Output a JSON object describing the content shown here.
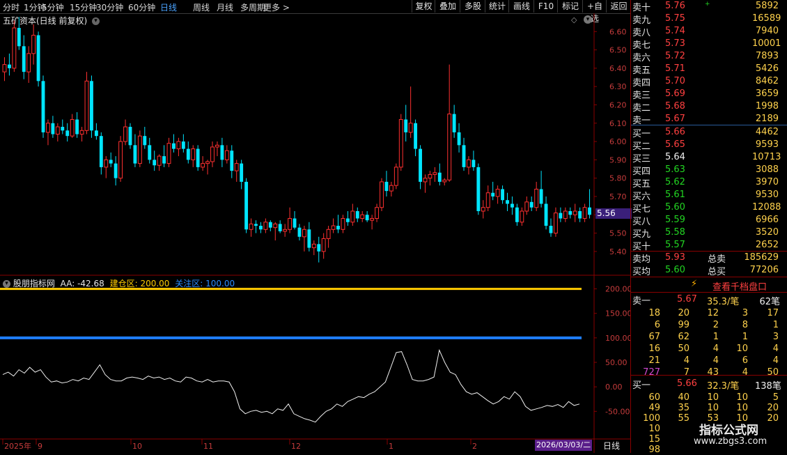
{
  "toolbar": {
    "periods": [
      "分时",
      "1分钟",
      "5分钟",
      "15分钟",
      "30分钟",
      "60分钟",
      "日线",
      "周线",
      "月线",
      "多周期",
      "更多 >"
    ],
    "active": "日线",
    "right_buttons": [
      "复权",
      "叠加",
      "多股",
      "统计",
      "画线",
      "F10",
      "标记",
      "+自选",
      "返回"
    ]
  },
  "stock": {
    "title": "五矿资本(日线 前复权)",
    "current_price_tag": "5.56"
  },
  "price_axis": [
    "6.60",
    "6.50",
    "6.40",
    "6.30",
    "6.20",
    "6.10",
    "6.00",
    "5.90",
    "5.80",
    "5.70",
    "5.60",
    "5.50",
    "5.40"
  ],
  "indicator": {
    "name": "股朋指标网",
    "aa_label": "AA: -42.68",
    "build_label": "建仓区: 200.00",
    "watch_label": "关注区: 100.00",
    "axis": [
      "200.00",
      "150.00",
      "100.00",
      "50.00",
      "0.00",
      "-50.00"
    ]
  },
  "time_axis": {
    "labels": [
      "2025年",
      "9",
      "10",
      "11",
      "12",
      "1",
      "2"
    ],
    "cursor_date": "2026/03/03/二",
    "period_label": "日线"
  },
  "order_book": {
    "asks": [
      {
        "label": "卖十",
        "price": "5.76",
        "vol": "5892",
        "mark": "+"
      },
      {
        "label": "卖九",
        "price": "5.75",
        "vol": "16589",
        "mark": ""
      },
      {
        "label": "卖八",
        "price": "5.74",
        "vol": "7940",
        "mark": ""
      },
      {
        "label": "卖七",
        "price": "5.73",
        "vol": "10001",
        "mark": ""
      },
      {
        "label": "卖六",
        "price": "5.72",
        "vol": "7893",
        "mark": ""
      },
      {
        "label": "卖五",
        "price": "5.71",
        "vol": "5426",
        "mark": ""
      },
      {
        "label": "卖四",
        "price": "5.70",
        "vol": "8462",
        "mark": ""
      },
      {
        "label": "卖三",
        "price": "5.69",
        "vol": "3659",
        "mark": ""
      },
      {
        "label": "卖二",
        "price": "5.68",
        "vol": "1998",
        "mark": ""
      },
      {
        "label": "卖一",
        "price": "5.67",
        "vol": "2189",
        "mark": ""
      }
    ],
    "bids": [
      {
        "label": "买一",
        "price": "5.66",
        "vol": "4462",
        "color": "red"
      },
      {
        "label": "买二",
        "price": "5.65",
        "vol": "9593",
        "color": "red"
      },
      {
        "label": "买三",
        "price": "5.64",
        "vol": "10713",
        "color": "white"
      },
      {
        "label": "买四",
        "price": "5.63",
        "vol": "3088",
        "color": "green"
      },
      {
        "label": "买五",
        "price": "5.62",
        "vol": "3970",
        "color": "green"
      },
      {
        "label": "买六",
        "price": "5.61",
        "vol": "9530",
        "color": "green"
      },
      {
        "label": "买七",
        "price": "5.60",
        "vol": "12088",
        "color": "green"
      },
      {
        "label": "买八",
        "price": "5.59",
        "vol": "6966",
        "color": "green"
      },
      {
        "label": "买九",
        "price": "5.58",
        "vol": "3520",
        "color": "green"
      },
      {
        "label": "买十",
        "price": "5.57",
        "vol": "2652",
        "color": "green"
      }
    ],
    "avg_sell": {
      "label": "卖均",
      "price": "5.93",
      "total_label": "总卖",
      "total": "185629"
    },
    "avg_buy": {
      "label": "买均",
      "price": "5.60",
      "total_label": "总买",
      "total": "77206"
    },
    "thousand_button": "查看千档盘口",
    "sell1": {
      "label": "卖一",
      "price": "5.67",
      "amount": "35.3/笔",
      "count": "62笔"
    },
    "sell_queue": [
      [
        "18",
        "20",
        "12",
        "3",
        "17"
      ],
      [
        "6",
        "99",
        "2",
        "8",
        "1"
      ],
      [
        "67",
        "62",
        "1",
        "1",
        "3"
      ],
      [
        "16",
        "50",
        "4",
        "10",
        "4"
      ],
      [
        "21",
        "4",
        "4",
        "6",
        "4"
      ],
      [
        "727",
        "7",
        "43",
        "4",
        "50"
      ]
    ],
    "buy1": {
      "label": "买一",
      "price": "5.66",
      "amount": "32.3/笔",
      "count": "138笔"
    },
    "buy_queue": [
      [
        "60",
        "40",
        "10",
        "10",
        "5"
      ],
      [
        "49",
        "35",
        "10",
        "10",
        "20"
      ],
      [
        "100",
        "55",
        "53",
        "10",
        "20"
      ],
      [
        "10",
        "",
        "",
        "",
        ""
      ],
      [
        "15",
        "",
        "",
        "",
        ""
      ],
      [
        "98",
        "",
        "",
        "",
        ""
      ]
    ]
  },
  "watermark": {
    "line1": "指标公式网",
    "line2": "www.zbgs3.com"
  },
  "chart_data": {
    "type": "candlestick",
    "x": [
      "2025-08-29",
      "2025-09",
      "2025-10",
      "2025-11",
      "2025-12",
      "2026-01",
      "2026-02",
      "2026-03-03"
    ],
    "candles": [
      [
        6.38,
        6.46,
        6.33,
        6.42
      ],
      [
        6.42,
        6.48,
        6.36,
        6.4
      ],
      [
        6.4,
        6.66,
        6.38,
        6.62
      ],
      [
        6.62,
        6.68,
        6.5,
        6.52
      ],
      [
        6.52,
        6.58,
        6.34,
        6.38
      ],
      [
        6.38,
        6.52,
        6.32,
        6.48
      ],
      [
        6.48,
        6.64,
        6.42,
        6.58
      ],
      [
        6.58,
        6.6,
        6.3,
        6.33
      ],
      [
        6.33,
        6.36,
        6.02,
        6.05
      ],
      [
        6.05,
        6.12,
        5.98,
        6.1
      ],
      [
        6.1,
        6.14,
        6.02,
        6.04
      ],
      [
        6.04,
        6.1,
        6.0,
        6.08
      ],
      [
        6.08,
        6.12,
        6.04,
        6.06
      ],
      [
        6.06,
        6.1,
        6.0,
        6.03
      ],
      [
        6.03,
        6.15,
        6.02,
        6.12
      ],
      [
        6.12,
        6.16,
        6.02,
        6.04
      ],
      [
        6.04,
        6.08,
        6.0,
        6.06
      ],
      [
        6.06,
        6.38,
        6.04,
        6.33
      ],
      [
        6.33,
        6.36,
        6.02,
        6.06
      ],
      [
        6.06,
        6.1,
        6.01,
        6.03
      ],
      [
        6.03,
        6.05,
        5.82,
        5.86
      ],
      [
        5.86,
        5.92,
        5.8,
        5.9
      ],
      [
        5.9,
        5.94,
        5.86,
        5.88
      ],
      [
        5.88,
        5.92,
        5.76,
        5.8
      ],
      [
        5.8,
        6.03,
        5.78,
        6.0
      ],
      [
        6.0,
        6.12,
        5.98,
        6.08
      ],
      [
        6.08,
        6.1,
        5.96,
        5.98
      ],
      [
        5.98,
        6.04,
        5.86,
        5.88
      ],
      [
        5.88,
        6.06,
        5.86,
        6.03
      ],
      [
        6.03,
        6.08,
        5.96,
        5.98
      ],
      [
        5.98,
        6.02,
        5.88,
        5.9
      ],
      [
        5.9,
        5.95,
        5.84,
        5.87
      ],
      [
        5.87,
        5.93,
        5.84,
        5.92
      ],
      [
        5.92,
        5.98,
        5.86,
        5.88
      ],
      [
        5.88,
        6.02,
        5.86,
        5.99
      ],
      [
        5.99,
        6.04,
        5.94,
        5.96
      ],
      [
        5.96,
        6.02,
        5.92,
        6.0
      ],
      [
        6.0,
        6.04,
        5.94,
        5.96
      ],
      [
        5.96,
        6.0,
        5.88,
        5.9
      ],
      [
        5.9,
        5.98,
        5.86,
        5.96
      ],
      [
        5.96,
        5.98,
        5.84,
        5.86
      ],
      [
        5.86,
        5.92,
        5.84,
        5.88
      ],
      [
        5.88,
        5.9,
        5.82,
        5.89
      ],
      [
        5.89,
        6.0,
        5.86,
        5.97
      ],
      [
        5.97,
        6.0,
        5.92,
        5.98
      ],
      [
        5.98,
        6.02,
        5.86,
        5.9
      ],
      [
        5.9,
        5.98,
        5.88,
        5.95
      ],
      [
        5.95,
        5.98,
        5.8,
        5.84
      ],
      [
        5.84,
        5.9,
        5.78,
        5.88
      ],
      [
        5.88,
        5.9,
        5.74,
        5.78
      ],
      [
        5.78,
        5.8,
        5.5,
        5.52
      ],
      [
        5.52,
        5.58,
        5.48,
        5.55
      ],
      [
        5.55,
        5.57,
        5.5,
        5.54
      ],
      [
        5.54,
        5.56,
        5.5,
        5.52
      ],
      [
        5.52,
        5.58,
        5.5,
        5.56
      ],
      [
        5.56,
        5.57,
        5.51,
        5.53
      ],
      [
        5.53,
        5.56,
        5.46,
        5.55
      ],
      [
        5.55,
        5.57,
        5.5,
        5.51
      ],
      [
        5.51,
        5.55,
        5.48,
        5.52
      ],
      [
        5.52,
        5.64,
        5.5,
        5.58
      ],
      [
        5.58,
        5.62,
        5.52,
        5.53
      ],
      [
        5.53,
        5.55,
        5.46,
        5.48
      ],
      [
        5.48,
        5.54,
        5.4,
        5.52
      ],
      [
        5.52,
        5.56,
        5.4,
        5.42
      ],
      [
        5.42,
        5.46,
        5.38,
        5.44
      ],
      [
        5.44,
        5.48,
        5.34,
        5.4
      ],
      [
        5.4,
        5.5,
        5.36,
        5.47
      ],
      [
        5.47,
        5.54,
        5.42,
        5.52
      ],
      [
        5.52,
        5.58,
        5.5,
        5.54
      ],
      [
        5.54,
        5.6,
        5.5,
        5.52
      ],
      [
        5.52,
        5.6,
        5.5,
        5.58
      ],
      [
        5.58,
        5.62,
        5.54,
        5.56
      ],
      [
        5.56,
        5.66,
        5.54,
        5.62
      ],
      [
        5.62,
        5.64,
        5.56,
        5.58
      ],
      [
        5.58,
        5.62,
        5.56,
        5.6
      ],
      [
        5.6,
        5.62,
        5.56,
        5.57
      ],
      [
        5.57,
        5.6,
        5.52,
        5.58
      ],
      [
        5.58,
        5.66,
        5.56,
        5.64
      ],
      [
        5.64,
        5.8,
        5.62,
        5.78
      ],
      [
        5.78,
        5.84,
        5.7,
        5.73
      ],
      [
        5.73,
        5.78,
        5.7,
        5.76
      ],
      [
        5.76,
        5.88,
        5.74,
        5.86
      ],
      [
        5.86,
        6.15,
        5.84,
        6.12
      ],
      [
        6.12,
        6.2,
        6.0,
        6.05
      ],
      [
        6.05,
        6.3,
        6.02,
        6.1
      ],
      [
        6.1,
        6.12,
        5.92,
        5.96
      ],
      [
        5.96,
        5.98,
        5.74,
        5.78
      ],
      [
        5.78,
        5.82,
        5.72,
        5.8
      ],
      [
        5.8,
        5.84,
        5.76,
        5.82
      ],
      [
        5.82,
        5.86,
        5.78,
        5.83
      ],
      [
        5.83,
        5.88,
        5.76,
        5.78
      ],
      [
        5.78,
        5.8,
        5.76,
        5.79
      ],
      [
        5.79,
        6.42,
        5.78,
        6.15
      ],
      [
        6.15,
        6.2,
        6.02,
        6.05
      ],
      [
        6.05,
        6.1,
        5.94,
        5.98
      ],
      [
        5.98,
        6.02,
        5.84,
        5.86
      ],
      [
        5.86,
        5.92,
        5.82,
        5.9
      ],
      [
        5.9,
        5.95,
        5.84,
        5.86
      ],
      [
        5.86,
        5.88,
        5.6,
        5.62
      ],
      [
        5.62,
        5.68,
        5.58,
        5.64
      ],
      [
        5.64,
        5.76,
        5.62,
        5.72
      ],
      [
        5.72,
        5.78,
        5.68,
        5.7
      ],
      [
        5.7,
        5.76,
        5.66,
        5.74
      ],
      [
        5.74,
        5.76,
        5.66,
        5.68
      ],
      [
        5.68,
        5.72,
        5.62,
        5.66
      ],
      [
        5.66,
        5.7,
        5.6,
        5.64
      ],
      [
        5.64,
        5.66,
        5.54,
        5.56
      ],
      [
        5.56,
        5.64,
        5.54,
        5.62
      ],
      [
        5.62,
        5.7,
        5.6,
        5.67
      ],
      [
        5.67,
        5.7,
        5.62,
        5.64
      ],
      [
        5.64,
        5.78,
        5.62,
        5.74
      ],
      [
        5.74,
        5.84,
        5.64,
        5.66
      ],
      [
        5.66,
        5.7,
        5.52,
        5.54
      ],
      [
        5.54,
        5.58,
        5.48,
        5.5
      ],
      [
        5.5,
        5.64,
        5.48,
        5.61
      ],
      [
        5.61,
        5.64,
        5.56,
        5.58
      ],
      [
        5.58,
        5.64,
        5.56,
        5.62
      ],
      [
        5.62,
        5.64,
        5.58,
        5.6
      ],
      [
        5.6,
        5.66,
        5.56,
        5.62
      ],
      [
        5.62,
        5.64,
        5.56,
        5.58
      ],
      [
        5.58,
        5.66,
        5.56,
        5.64
      ],
      [
        5.64,
        5.74,
        5.58,
        5.6
      ]
    ],
    "indicator_AA": [
      25,
      30,
      22,
      35,
      28,
      40,
      30,
      35,
      20,
      10,
      12,
      8,
      10,
      15,
      12,
      18,
      15,
      30,
      45,
      25,
      15,
      12,
      12,
      18,
      20,
      18,
      15,
      22,
      18,
      20,
      15,
      18,
      12,
      10,
      20,
      18,
      12,
      10,
      15,
      10,
      12,
      12,
      10,
      -10,
      -45,
      -55,
      -50,
      -48,
      -52,
      -50,
      -55,
      -45,
      -48,
      -35,
      -55,
      -60,
      -65,
      -68,
      -72,
      -60,
      -50,
      -45,
      -35,
      -40,
      -30,
      -25,
      -20,
      -22,
      -15,
      -10,
      0,
      10,
      40,
      70,
      72,
      45,
      15,
      12,
      12,
      15,
      20,
      75,
      50,
      30,
      25,
      5,
      -10,
      -15,
      -12,
      -20,
      -28,
      -35,
      -30,
      -20,
      -25,
      -10,
      -20,
      -40,
      -48,
      -45,
      -42,
      -38,
      -40,
      -36,
      -42,
      -30,
      -38,
      -35
    ],
    "build_zone": 200,
    "watch_zone": 100,
    "price_range": [
      5.35,
      6.7
    ],
    "indicator_range": [
      -105,
      225
    ],
    "last_close": 5.56
  }
}
